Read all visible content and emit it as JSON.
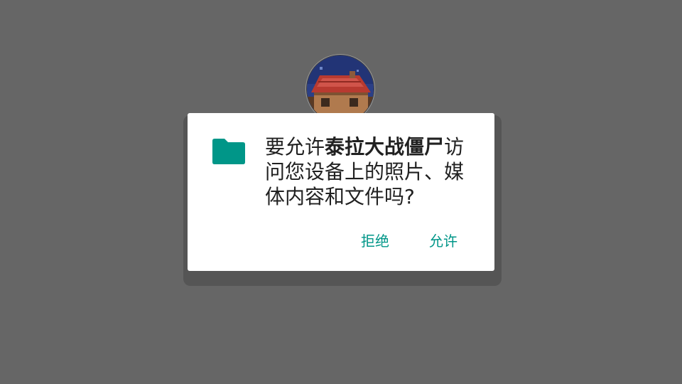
{
  "background_app": {
    "icon": "app-icon-house-pixel-art"
  },
  "dialog": {
    "icon": "folder-icon",
    "message_prefix": "要允许",
    "app_name": "泰拉大战僵尸",
    "message_suffix": "访问您设备上的照片、媒体内容和文件吗?",
    "deny_label": "拒绝",
    "allow_label": "允许"
  },
  "colors": {
    "scrim": "#666666",
    "accent": "#009688",
    "dialog_bg": "#ffffff",
    "text": "#212121"
  }
}
